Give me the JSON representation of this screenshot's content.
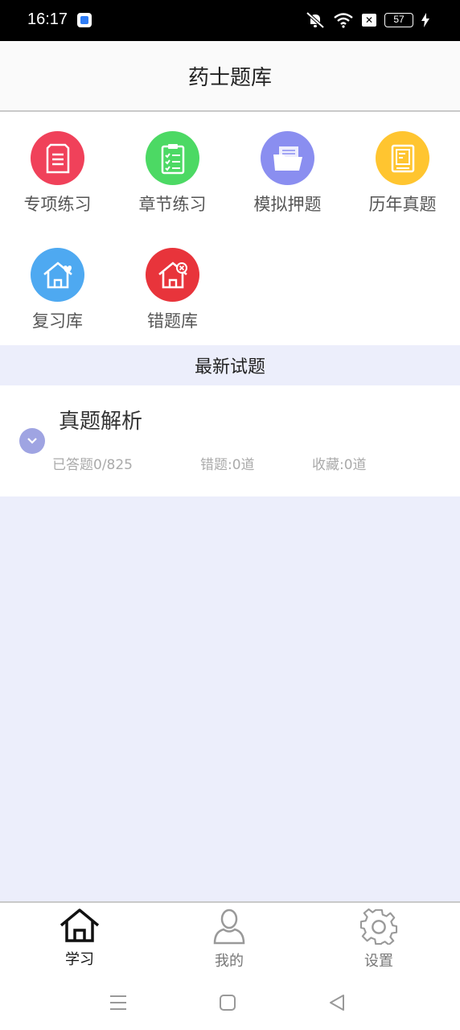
{
  "status_bar": {
    "time": "16:17",
    "battery": "57",
    "icons": [
      "app-icon",
      "mute-icon",
      "wifi-icon",
      "sim-icon",
      "battery-icon",
      "charging-icon"
    ]
  },
  "header": {
    "title": "药士题库"
  },
  "menu": {
    "items": [
      {
        "label": "专项练习",
        "icon": "document-icon",
        "color": "#f0415a"
      },
      {
        "label": "章节练习",
        "icon": "clipboard-check-icon",
        "color": "#4cd964"
      },
      {
        "label": "模拟押题",
        "icon": "folder-icon",
        "color": "#8a8ef0"
      },
      {
        "label": "历年真题",
        "icon": "book-icon",
        "color": "#ffc530"
      },
      {
        "label": "复习库",
        "icon": "house-heart-icon",
        "color": "#4ea9f1"
      },
      {
        "label": "错题库",
        "icon": "house-x-icon",
        "color": "#e8343b"
      }
    ]
  },
  "section": {
    "title": "最新试题"
  },
  "card": {
    "title": "真题解析",
    "answered": "已答题0/825",
    "wrong": "错题:0道",
    "favorites": "收藏:0道",
    "accent": "#9fa4e2"
  },
  "tabs": [
    {
      "label": "学习",
      "icon": "home-icon",
      "active": true
    },
    {
      "label": "我的",
      "icon": "user-icon",
      "active": false
    },
    {
      "label": "设置",
      "icon": "gear-icon",
      "active": false
    }
  ],
  "background_color": "#eceefb"
}
